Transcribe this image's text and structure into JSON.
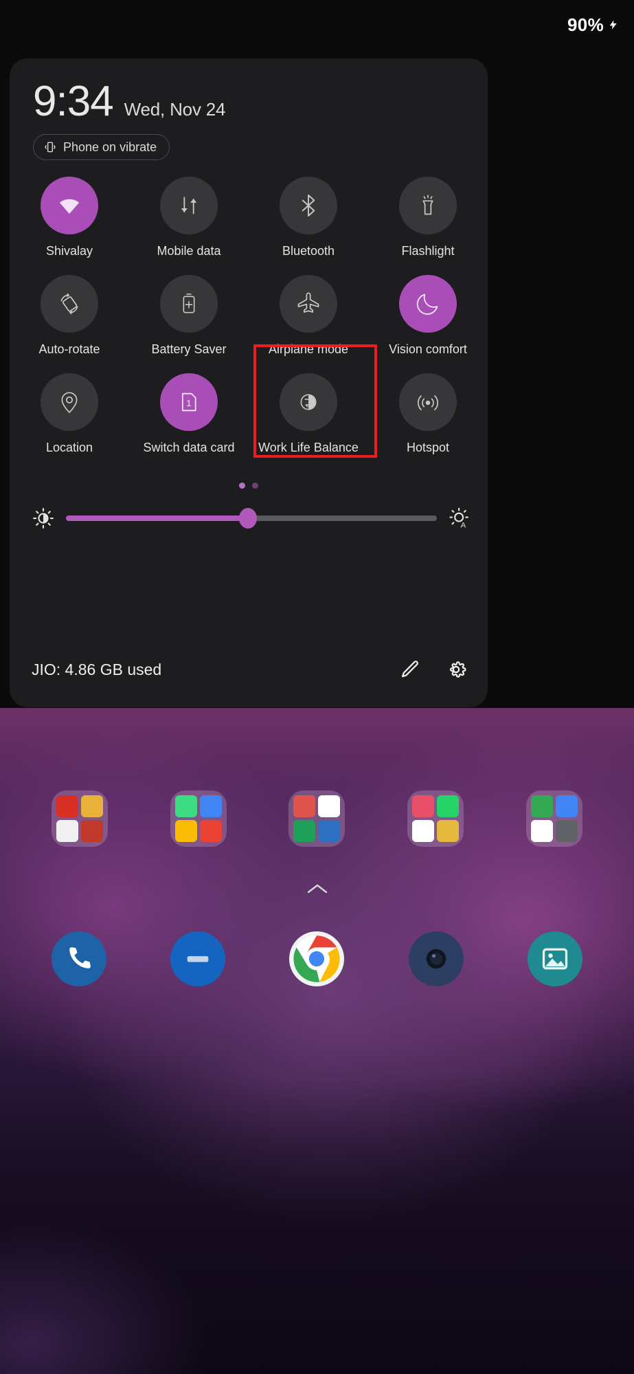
{
  "status_bar": {
    "battery_percent": "90%",
    "charging_icon": "lightning-bolt-icon"
  },
  "quick_settings": {
    "clock_time": "9:34",
    "clock_date": "Wed, Nov 24",
    "ringer_chip": {
      "label": "Phone on vibrate",
      "icon": "phone-vibrate-icon"
    },
    "tiles": [
      {
        "label": "Shivalay",
        "icon": "wifi-icon",
        "active": true
      },
      {
        "label": "Mobile data",
        "icon": "mobile-data-icon",
        "active": false
      },
      {
        "label": "Bluetooth",
        "icon": "bluetooth-icon",
        "active": false
      },
      {
        "label": "Flashlight",
        "icon": "flashlight-icon",
        "active": false
      },
      {
        "label": "Auto-rotate",
        "icon": "auto-rotate-icon",
        "active": false
      },
      {
        "label": "Battery Saver",
        "icon": "battery-saver-icon",
        "active": false
      },
      {
        "label": "Airplane mode",
        "icon": "airplane-icon",
        "active": false
      },
      {
        "label": "Vision comfort",
        "icon": "moon-icon",
        "active": true
      },
      {
        "label": "Location",
        "icon": "location-pin-icon",
        "active": false
      },
      {
        "label": "Switch data card",
        "icon": "sim-card-1-icon",
        "active": true
      },
      {
        "label": "Work Life Balance",
        "icon": "work-life-balance-icon",
        "active": false
      },
      {
        "label": "Hotspot",
        "icon": "hotspot-icon",
        "active": false
      }
    ],
    "highlight": {
      "target_tile": "Airplane mode",
      "color": "#ec1b24"
    },
    "pagination": {
      "pages": 2,
      "current": 1
    },
    "brightness": {
      "value_percent": 49,
      "left_icon": "brightness-medium-icon",
      "right_icon": "brightness-auto-icon",
      "accent_color": "#b158bd"
    },
    "footer": {
      "data_usage": "JIO: 4.86 GB used",
      "edit_icon": "pencil-icon",
      "settings_icon": "gear-icon"
    }
  },
  "home_screen": {
    "folders": [
      {
        "name": "folder-1",
        "tiles": [
          "#d93025",
          "#e8b23a",
          "#f0f0f0",
          "#c0392b"
        ]
      },
      {
        "name": "folder-2",
        "tiles": [
          "#3ddc84",
          "#4285f4",
          "#fbbc05",
          "#ea4335"
        ]
      },
      {
        "name": "folder-3",
        "tiles": [
          "#e0544e",
          "#ffffff",
          "#1fa05a",
          "#2f6fbf"
        ]
      },
      {
        "name": "folder-4",
        "tiles": [
          "#e94f69",
          "#25d366",
          "#ffffff",
          "#e5b93c"
        ]
      },
      {
        "name": "folder-5",
        "tiles": [
          "#34a853",
          "#4285f4",
          "#ffffff",
          "#5f6368"
        ]
      }
    ],
    "page_arrow_icon": "chevron-up-icon",
    "dock": [
      {
        "name": "phone",
        "icon": "phone-icon",
        "bg": "#1e63a8"
      },
      {
        "name": "messages",
        "icon": "messages-icon",
        "bg": "#1565c0"
      },
      {
        "name": "chrome",
        "icon": "chrome-icon",
        "bg": "#f1f3f4"
      },
      {
        "name": "camera",
        "icon": "camera-icon",
        "bg": "#2c3f63"
      },
      {
        "name": "gallery",
        "icon": "gallery-icon",
        "bg": "#1f8a8f"
      }
    ]
  }
}
